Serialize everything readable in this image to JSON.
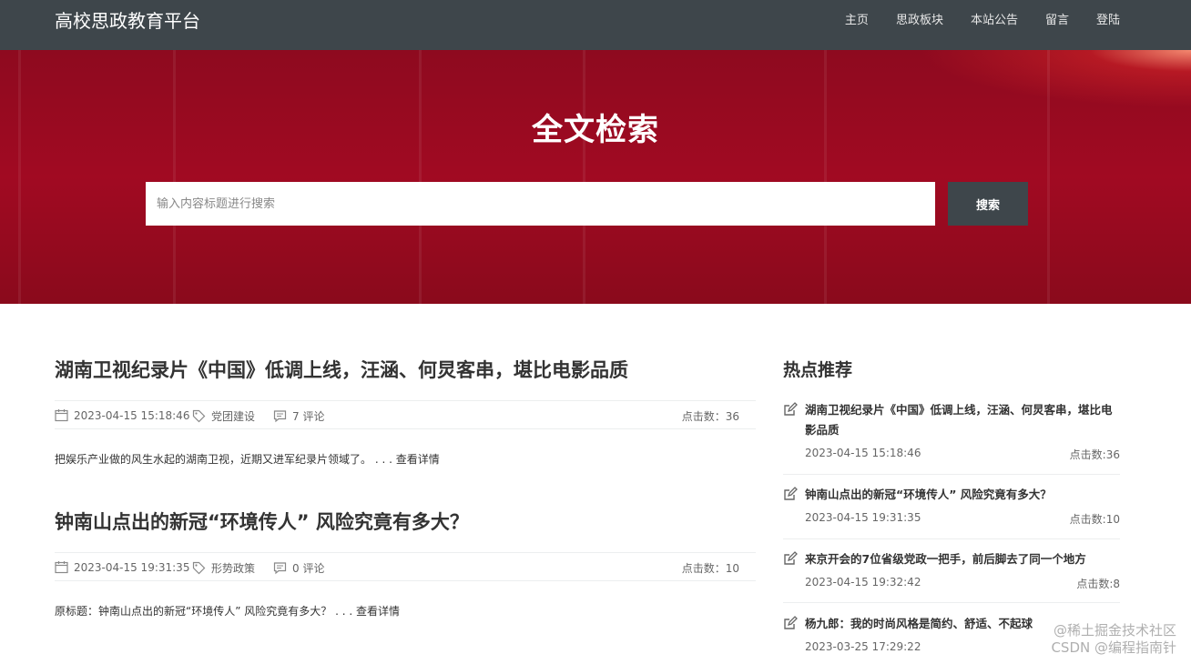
{
  "header": {
    "brand": "高校思政教育平台",
    "nav": [
      "主页",
      "思政板块",
      "本站公告",
      "留言",
      "登陆"
    ]
  },
  "hero": {
    "title": "全文检索",
    "search_placeholder": "输入内容标题进行搜索",
    "search_button": "搜索"
  },
  "articles": [
    {
      "title": "湖南卫视纪录片《中国》低调上线，汪涵、何炅客串，堪比电影品质",
      "date": "2023-04-15 15:18:46",
      "category": "党团建设",
      "comments": "7 评论",
      "clicks": "点击数：36",
      "summary": "把娱乐产业做的风生水起的湖南卫视，近期又进军纪录片领域了。",
      "more": " . . . 查看详情"
    },
    {
      "title": "钟南山点出的新冠“环境传人” 风险究竟有多大？",
      "date": "2023-04-15 19:31:35",
      "category": "形势政策",
      "comments": "0 评论",
      "clicks": "点击数：10",
      "summary": "原标题：钟南山点出的新冠“环境传人” 风险究竟有多大？",
      "more": " . . . 查看详情"
    }
  ],
  "sidebar": {
    "title": "热点推荐",
    "items": [
      {
        "title": "湖南卫视纪录片《中国》低调上线，汪涵、何炅客串，堪比电影品质",
        "date": "2023-04-15 15:18:46",
        "clicks": "点击数:36"
      },
      {
        "title": "钟南山点出的新冠“环境传人” 风险究竟有多大？",
        "date": "2023-04-15 19:31:35",
        "clicks": "点击数:10"
      },
      {
        "title": "来京开会的7位省级党政一把手，前后脚去了同一个地方",
        "date": "2023-04-15 19:32:42",
        "clicks": "点击数:8"
      },
      {
        "title": "杨九郎：我的时尚风格是简约、舒适、不起球",
        "date": "2023-03-25 17:29:22",
        "clicks": ""
      }
    ]
  },
  "watermark": {
    "line1": "@稀土掘金技术社区",
    "line2": "CSDN @编程指南针"
  },
  "colors": {
    "topbar": "#3e464b",
    "hero_red": "#a10a22",
    "button": "#3e464b"
  }
}
